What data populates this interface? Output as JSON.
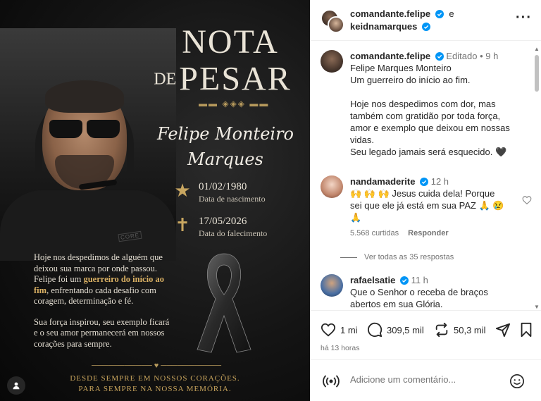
{
  "post_image": {
    "title_line1": "NOTA",
    "title_de": "DE",
    "title_pesar": "PESAR",
    "name_line1": "Felipe Monteiro",
    "name_line2": "Marques",
    "birth_date": "01/02/1980",
    "birth_label": "Data de nascimento",
    "death_date": "17/05/2026",
    "death_label": "Data do falecimento",
    "para1_before": "Hoje nos despedimos de alguém que deixou sua marca por onde passou. Felipe foi um ",
    "para1_highlight": "guerreiro do início ao fim",
    "para1_after": ", enfrentando cada desafio com coragem, determinação e fé.",
    "para2": "Sua força inspirou, seu exemplo ficará e o seu amor permanecerá em nossos corações para sempre.",
    "footer_line1": "DESDE SEMPRE EM NOSSOS CORAÇÕES.",
    "footer_line2": "PARA SEMPRE NA NOSSA MEMÓRIA.",
    "shirt_text": "CORE",
    "accent_gold": "#c9a55d"
  },
  "header": {
    "user1": "comandante.felipe",
    "and_word": "e",
    "user2": "keidnamarques",
    "more_icon": "more-horizontal-icon"
  },
  "caption": {
    "username": "comandante.felipe",
    "edited": "Editado",
    "dot": "•",
    "time": "9 h",
    "lines": [
      "Felipe Marques Monteiro",
      "Um guerreiro do início ao fim.",
      "",
      "Hoje nos despedimos com dor, mas",
      "também com gratidão por toda força,",
      "amor e exemplo que deixou em nossas",
      "vidas.",
      "Seu legado jamais será esquecido. 🖤"
    ]
  },
  "comments": [
    {
      "username": "nandamaderite",
      "time": "12 h",
      "text": "🙌 🙌 🙌  Jesus cuida dela! Porque sei que ele já está em sua PAZ 🙏 😢 🙏",
      "likes": "5.568 curtidas",
      "reply": "Responder"
    },
    {
      "username": "rafaelsatie",
      "time": "11 h",
      "text": "Que o Senhor o receba de braços abertos em sua Glória."
    }
  ],
  "view_replies": "Ver todas as 35 respostas",
  "actions": {
    "likes": "1 mi",
    "comments": "309,5 mil",
    "reposts": "50,3 mil"
  },
  "post_time": "há 13 horas",
  "comment_input": {
    "placeholder": "Adicione um comentário..."
  },
  "colors": {
    "verified_blue": "#0095f6",
    "text_secondary": "#737373"
  }
}
